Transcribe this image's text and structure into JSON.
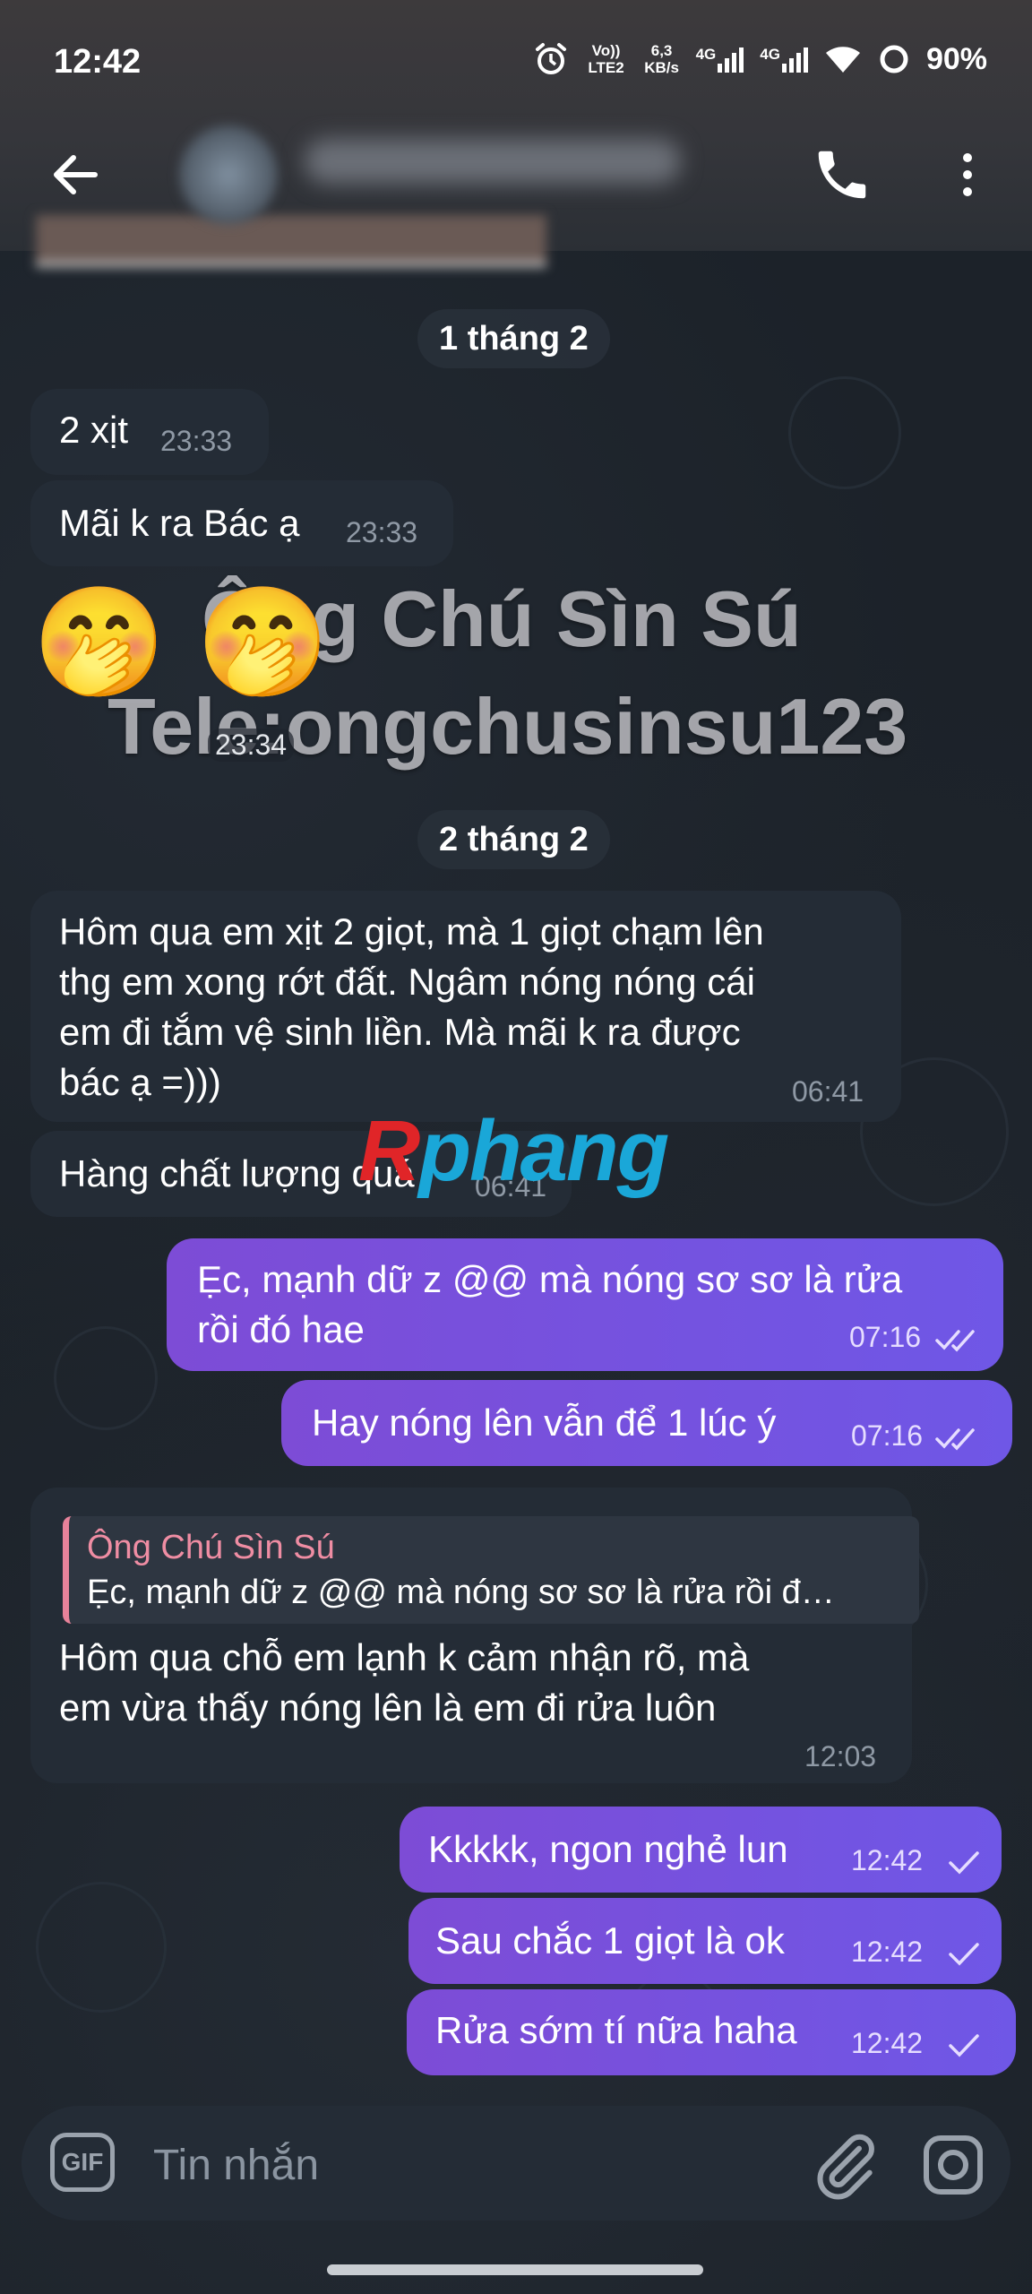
{
  "status_bar": {
    "time": "12:42",
    "volte": "Vo)) LTE2",
    "speed": "6,3 KB/s",
    "net1": "4G",
    "net2": "4G",
    "battery": "90%"
  },
  "header": {
    "back_icon": "arrow-left-icon",
    "call_icon": "phone-icon",
    "more_icon": "more-vertical-icon"
  },
  "messages": {
    "date1": "1 tháng 2",
    "m1": {
      "text": "2 xịt",
      "time": "23:33"
    },
    "m2": {
      "text": "Mãi k ra Bác ạ",
      "time": "23:33"
    },
    "sticker": {
      "emoji": "🤭 🤭",
      "time": "23:34"
    },
    "date2": "2 tháng 2",
    "m3": {
      "lines": [
        "Hôm qua em xịt 2 giọt, mà 1 giọt chạm lên",
        "thg em xong rớt đất. Ngâm nóng nóng cái",
        "em đi tắm vệ sinh liền. Mà mãi k ra được",
        "bác ạ =)))"
      ],
      "time": "06:41"
    },
    "m4": {
      "text": "Hàng chất lượng quá",
      "time": "06:41"
    },
    "m5": {
      "lines": [
        "Ẹc, mạnh dữ z @@ mà nóng sơ sơ là rửa",
        "rồi đó hae"
      ],
      "time": "07:16"
    },
    "m6": {
      "text": "Hay nóng lên vẫn để 1 lúc ý",
      "time": "07:16"
    },
    "m7": {
      "reply_name": "Ông Chú Sìn Sú",
      "reply_text": "Ẹc, mạnh dữ z @@ mà nóng sơ sơ là rửa rồi đ…",
      "lines": [
        "Hôm qua chỗ em lạnh k cảm nhận rõ, mà",
        "em vừa thấy nóng lên là em đi rửa luôn"
      ],
      "time": "12:03"
    },
    "m8": {
      "text": "Kkkkk, ngon nghẻ lun",
      "time": "12:42"
    },
    "m9": {
      "text": "Sau chắc 1 giọt là ok",
      "time": "12:42"
    },
    "m10": {
      "text": "Rửa sớm tí nữa haha",
      "time": "12:42"
    }
  },
  "watermark": {
    "line1": "Ông Chú Sìn Sú",
    "line2": "Tele:ongchusinsu123"
  },
  "logo": {
    "part1": "R",
    "part2": "phang"
  },
  "composer": {
    "gif_label": "GIF",
    "placeholder": "Tin nhắn",
    "attach_icon": "paperclip-icon",
    "camera_icon": "camera-icon"
  },
  "colors": {
    "outgoing": "#7355e0",
    "incoming": "#242c36",
    "background": "#1c2229",
    "reply_accent": "#e7829a"
  }
}
